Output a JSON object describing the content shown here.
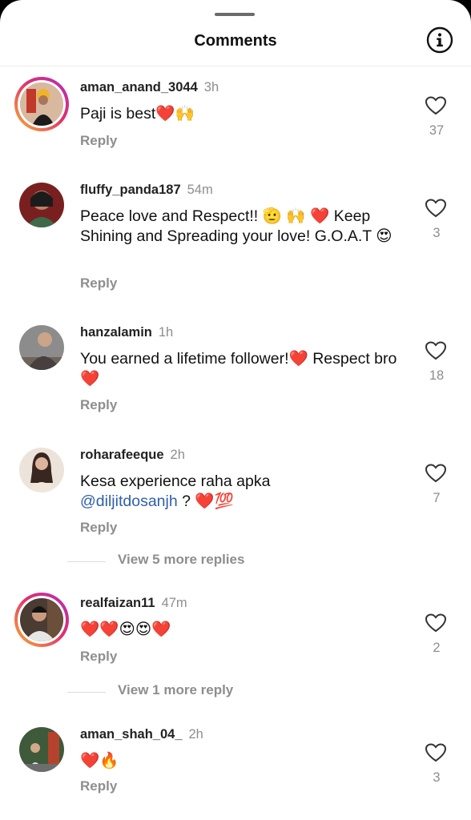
{
  "header": {
    "title": "Comments",
    "info_icon": "info-icon"
  },
  "comments": [
    {
      "username": "aman_anand_3044",
      "time": "3h",
      "text": "Paji is best❤️🙌",
      "reply_label": "Reply",
      "likes": "37"
    },
    {
      "username": "fluffy_panda187",
      "time": "54m",
      "text": "Peace love and Respect!! 🫡 🙌 ❤️ Keep Shining and Spreading your love! G.O.A.T 😍",
      "reply_label": "Reply",
      "likes": "3"
    },
    {
      "username": "hanzalamin",
      "time": "1h",
      "text": "You earned a lifetime follower!❤️ Respect bro❤️",
      "reply_label": "Reply",
      "likes": "18"
    },
    {
      "username": "roharafeeque",
      "time": "2h",
      "text_before": "Kesa experience raha apka",
      "mention": "@diljitdosanjh",
      "text_after": " ? ❤️💯",
      "reply_label": "Reply",
      "likes": "7"
    },
    {
      "username": "realfaizan11",
      "time": "47m",
      "text": "❤️❤️😍😍❤️",
      "reply_label": "Reply",
      "likes": "2"
    },
    {
      "username": "aman_shah_04_",
      "time": "2h",
      "text": "❤️🔥",
      "reply_label": "Reply",
      "likes": "3"
    }
  ],
  "view_more": [
    {
      "label": "View 5 more replies"
    },
    {
      "label": "View 1 more reply"
    }
  ],
  "colors": {
    "link": "#2f5fae",
    "muted": "#8e8e8e",
    "story_ring": "#e1306c"
  }
}
